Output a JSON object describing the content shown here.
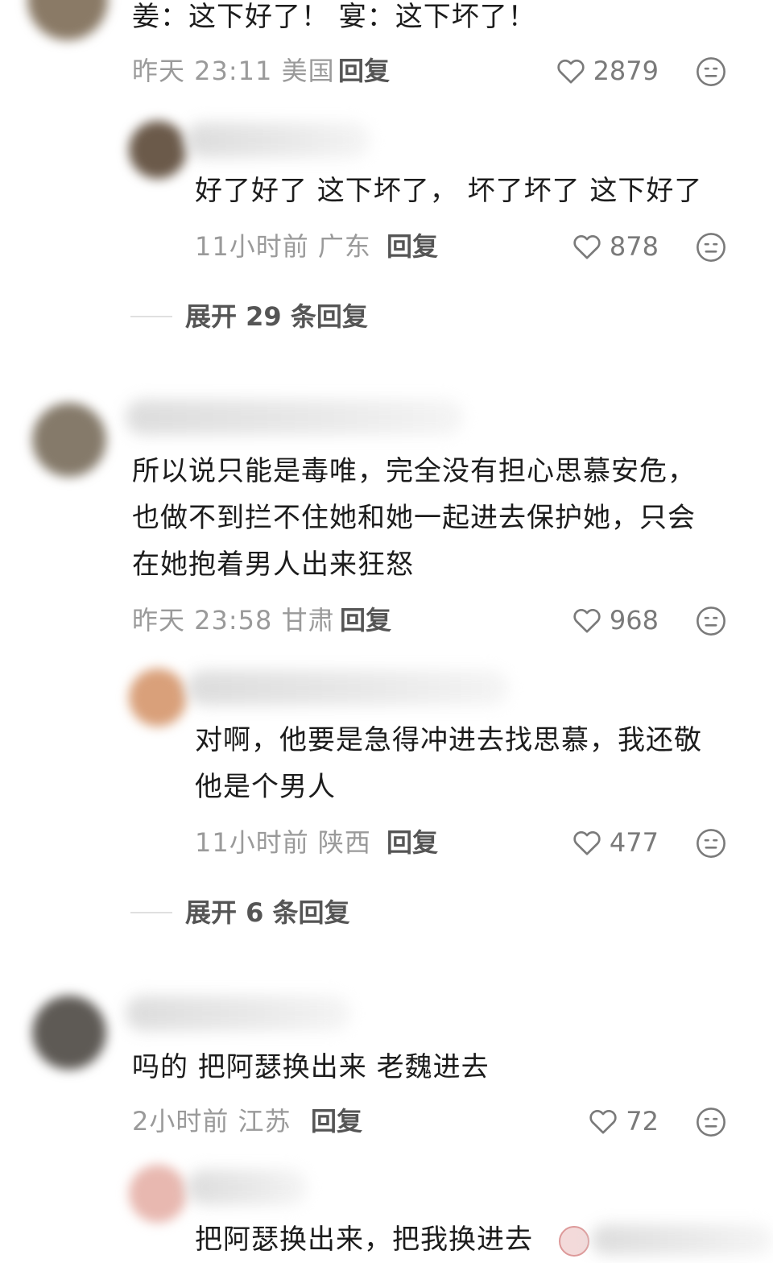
{
  "comments": [
    {
      "text": [
        "姜：这下好了！ 宴：这下坏了！"
      ],
      "meta": "昨天 23:11 美国",
      "reply_label": "回复",
      "likes": "2879",
      "replies": [
        {
          "text": [
            "好了好了 这下坏了， 坏了坏了 这下好了"
          ],
          "meta": "11小时前 广东",
          "reply_label": "回复",
          "likes": "878"
        }
      ],
      "expand_label": "展开 29 条回复"
    },
    {
      "text": [
        "所以说只能是毒唯，完全没有担心思慕安危，",
        "也做不到拦不住她和她一起进去保护她，只会",
        "在她抱着男人出来狂怒"
      ],
      "meta": "昨天 23:58 甘肃",
      "reply_label": "回复",
      "likes": "968",
      "replies": [
        {
          "text": [
            "对啊，他要是急得冲进去找思慕，我还敬",
            "他是个男人"
          ],
          "meta": "11小时前 陕西",
          "reply_label": "回复",
          "likes": "477"
        }
      ],
      "expand_label": "展开 6 条回复"
    },
    {
      "text": [
        "吗的 把阿瑟换出来 老魏进去"
      ],
      "meta": "2小时前 江苏",
      "reply_label": "回复",
      "likes": "72",
      "replies": [
        {
          "text": [
            "把阿瑟换出来，把我换进去"
          ]
        }
      ]
    }
  ],
  "icons": {
    "like": "heart-outline-icon",
    "dislike": "meh-face-icon"
  },
  "colors": {
    "text": "#1c1c1c",
    "meta": "#9a9a9a",
    "reply": "#555555"
  }
}
